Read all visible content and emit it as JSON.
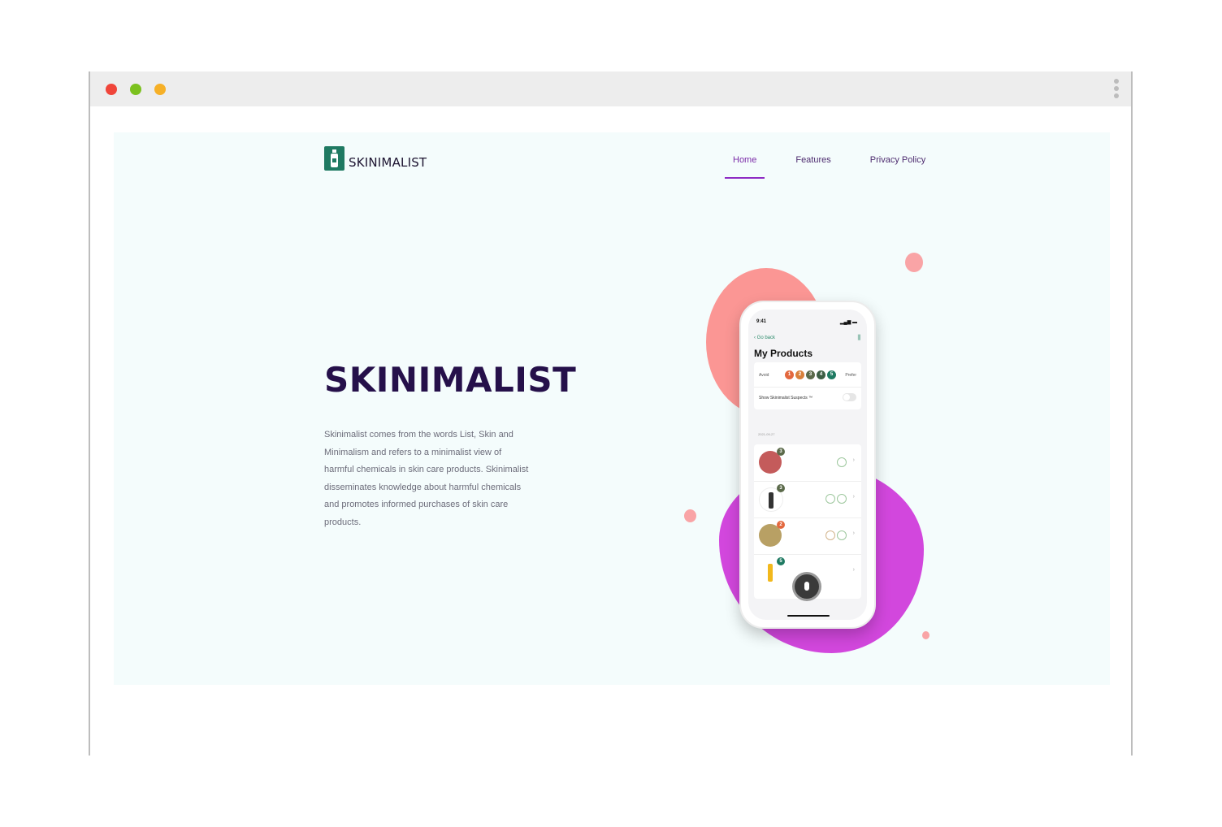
{
  "window": {
    "controls": [
      "close",
      "minimize",
      "maximize"
    ],
    "menu_icon": "kebab-menu-icon"
  },
  "brand": {
    "name": "SKINIMALIST",
    "logo_icon": "bottle-logo-icon",
    "color": "#1f7a62"
  },
  "nav": {
    "items": [
      {
        "label": "Home",
        "active": true
      },
      {
        "label": "Features"
      },
      {
        "label": "Privacy Policy"
      }
    ]
  },
  "hero": {
    "title": "SKINIMALIST",
    "description": "Skinimalist comes from the words List, Skin and Minimalism and refers to a minimalist view of harmful chemicals in skin care products. Skinimalist disseminates knowledge about harmful chemicals and promotes informed purchases of skin care products."
  },
  "phone": {
    "time": "9:41",
    "back_label": "Go back",
    "title": "My Products",
    "avoid_label": "Avoid",
    "prefer_label": "Prefer",
    "ratings": [
      "1",
      "2",
      "3",
      "4",
      "5"
    ],
    "toggle_label": "Show Skinimalist Suspects ™",
    "date": "2021-09-27",
    "products": [
      {
        "badge": "3"
      },
      {
        "badge": "3"
      },
      {
        "badge": "2"
      },
      {
        "badge": "5"
      }
    ]
  },
  "colors": {
    "accent": "#8e2bc4",
    "title": "#25104a",
    "page_bg": "#f4fcfc",
    "blob_pink": "#fb9694",
    "blob_purple": "#d247dd"
  }
}
